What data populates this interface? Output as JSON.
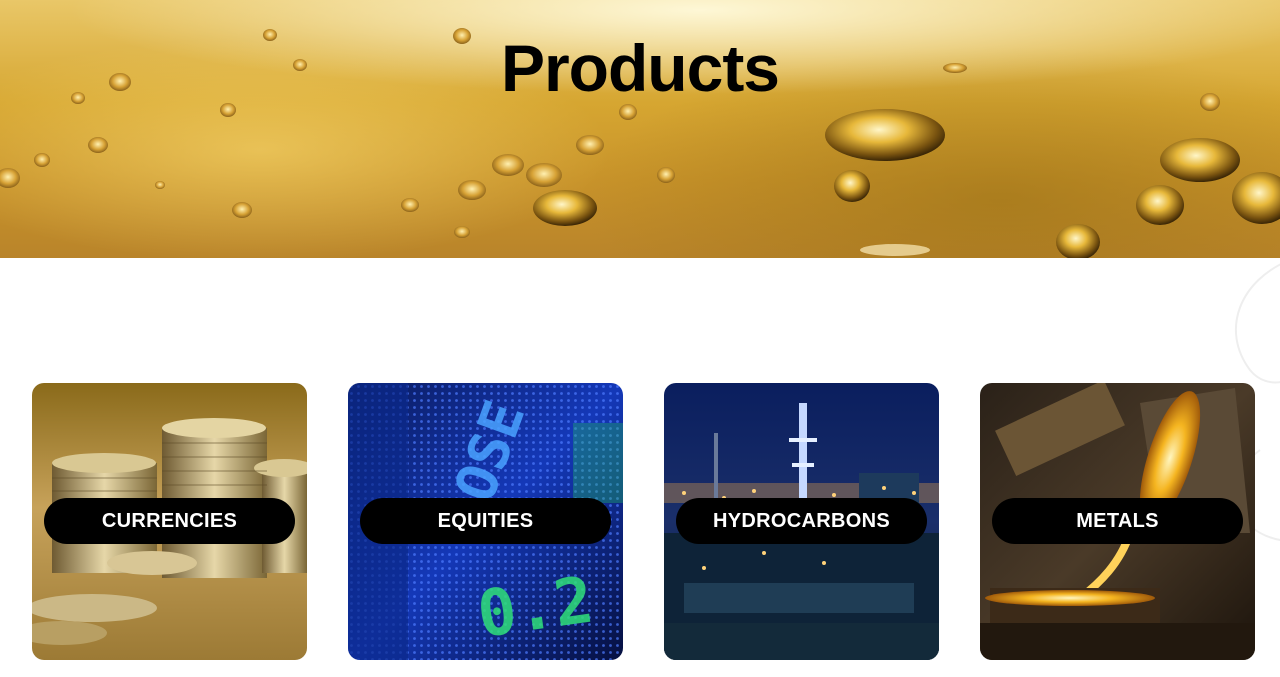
{
  "hero": {
    "title": "Products"
  },
  "products": [
    {
      "label": "CURRENCIES",
      "image": "coin-stacks-image"
    },
    {
      "label": "EQUITIES",
      "image": "stock-ticker-board-image"
    },
    {
      "label": "HYDROCARBONS",
      "image": "refinery-at-night-image"
    },
    {
      "label": "METALS",
      "image": "molten-metal-pour-image"
    }
  ],
  "colors": {
    "hero_gold": "#d6a631",
    "pill_bg": "#000000",
    "pill_text": "#ffffff"
  }
}
